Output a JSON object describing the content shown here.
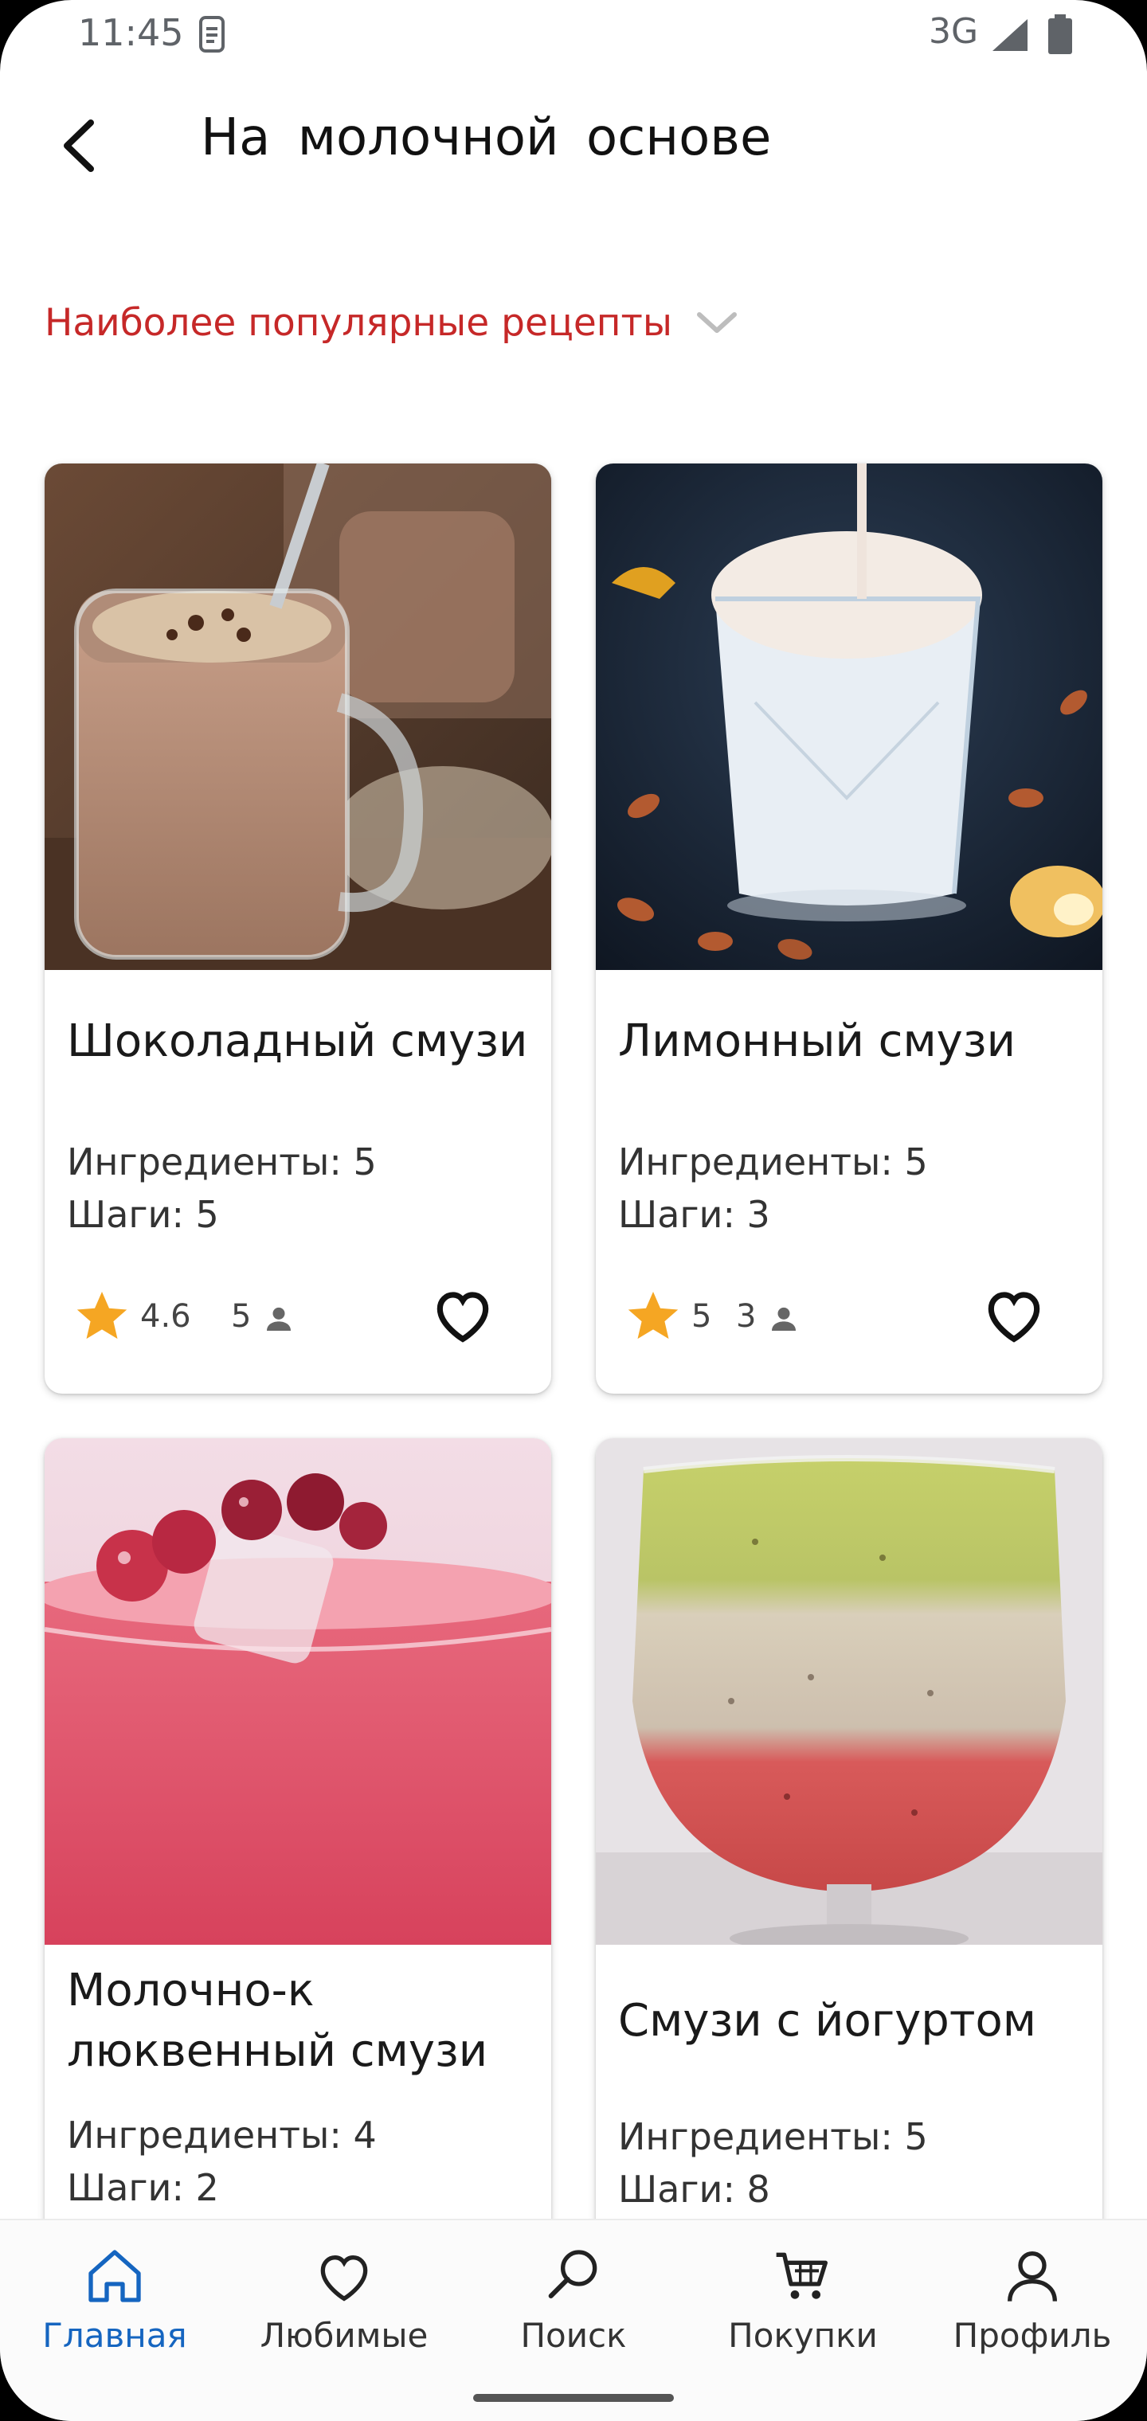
{
  "status": {
    "time": "11:45",
    "network": "3G"
  },
  "header": {
    "title": "На  молочной  основе"
  },
  "sort": {
    "label": "Наиболее популярные рецепты"
  },
  "cards": [
    {
      "title": "Шоколадный смузи",
      "ingredients": "Ингредиенты: 5",
      "steps": "Шаги: 5",
      "rating": "4.6",
      "votes": "5"
    },
    {
      "title": "Лимонный смузи",
      "ingredients": "Ингредиенты: 5",
      "steps": "Шаги: 3",
      "rating": "5",
      "votes": "3"
    },
    {
      "title": "Молочно-к люквенный смузи",
      "title_line1": "Молочно-к",
      "title_line2": "люквенный смузи",
      "ingredients": "Ингредиенты: 4",
      "steps": "Шаги: 2"
    },
    {
      "title": "Смузи с йогуртом",
      "ingredients": "Ингредиенты: 5",
      "steps": "Шаги: 8"
    }
  ],
  "nav": {
    "items": [
      {
        "label": "Главная",
        "icon": "home-icon",
        "active": true
      },
      {
        "label": "Любимые",
        "icon": "heart-icon"
      },
      {
        "label": "Поиск",
        "icon": "search-icon"
      },
      {
        "label": "Покупки",
        "icon": "cart-icon"
      },
      {
        "label": "Профиль",
        "icon": "person-icon"
      }
    ]
  },
  "colors": {
    "accent_red": "#c62828",
    "accent_blue": "#1565c0",
    "star": "#f5a623"
  }
}
